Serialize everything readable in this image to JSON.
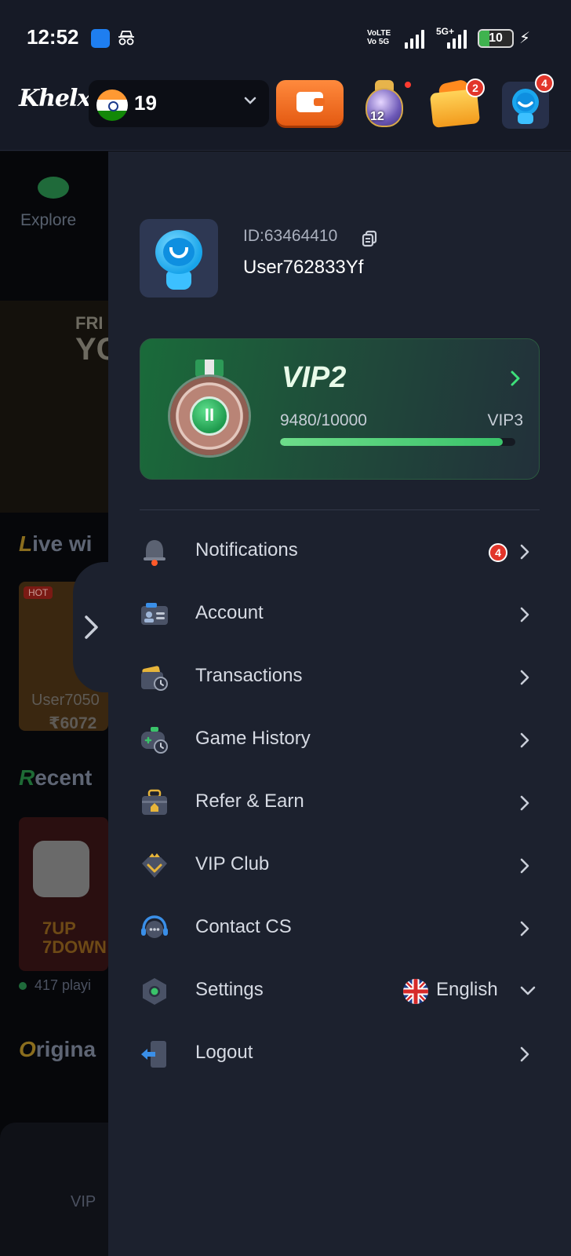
{
  "status_bar": {
    "time": "12:52",
    "network_label": "VoLTE Vo 5G",
    "network_type": "5G+",
    "battery": "10"
  },
  "header": {
    "logo": "Khelx",
    "balance": "19",
    "treasure_badge": "12",
    "chest_badge": "2",
    "avatar_badge": "4"
  },
  "background_page": {
    "explore": "Explore",
    "banner_line1": "FRI",
    "banner_line2": "YC",
    "live_heading_first": "L",
    "live_heading_rest": "ive wi",
    "hot": "HOT",
    "card_user": "User7050",
    "card_value": "₹6072",
    "recent_heading_first": "R",
    "recent_heading_rest": "ecent",
    "game_title": "7UP 7DOWN",
    "players": "417 playi",
    "original_heading_first": "O",
    "original_heading_rest": "rigina",
    "nav_vip": "VIP"
  },
  "profile": {
    "id": "ID:63464410",
    "username": "User762833Yf"
  },
  "vip": {
    "title": "VIP2",
    "progress_text": "9480/10000",
    "next_level": "VIP3",
    "progress": 0.948,
    "medal_label": "II"
  },
  "menu": [
    {
      "label": "Notifications",
      "badge": "4"
    },
    {
      "label": "Account"
    },
    {
      "label": "Transactions"
    },
    {
      "label": "Game History"
    },
    {
      "label": "Refer & Earn"
    },
    {
      "label": "VIP Club"
    },
    {
      "label": "Contact CS"
    },
    {
      "label": "Settings",
      "language": "English"
    },
    {
      "label": "Logout"
    }
  ],
  "colors": {
    "drawer_bg": "#1c212e",
    "accent_orange": "#ef6b20",
    "vip_green": "#1a6b3a",
    "badge_red": "#e2352a"
  }
}
